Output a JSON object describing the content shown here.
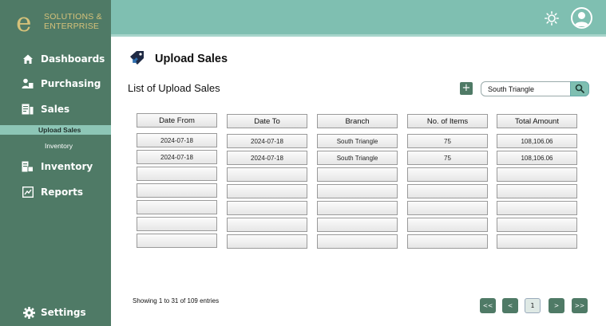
{
  "brand": {
    "line1": "SOLUTIONS &",
    "line2": "ENTERPRISE",
    "mark": "e"
  },
  "colors": {
    "sidebar": "#4f7a66",
    "header": "#7fbfb1",
    "active_sub": "#8dc6b6",
    "logo": "#d6c27a"
  },
  "sidebar": {
    "items": [
      {
        "label": "Dashboards",
        "icon": "home-icon"
      },
      {
        "label": "Purchasing",
        "icon": "users-icon"
      },
      {
        "label": "Sales",
        "icon": "sales-doc-icon"
      },
      {
        "label": "Inventory",
        "icon": "inventory-icon"
      },
      {
        "label": "Reports",
        "icon": "reports-icon"
      }
    ],
    "sales_sub": [
      {
        "label": "Upload Sales",
        "active": true
      },
      {
        "label": "Inventory",
        "active": false
      }
    ],
    "settings": {
      "label": "Settings",
      "icon": "gear-icon"
    }
  },
  "header": {
    "theme_icon": "sun-icon",
    "avatar_icon": "user-avatar-icon"
  },
  "page": {
    "title": "Upload Sales",
    "title_icon": "sales-tag-icon",
    "list_title": "List of Upload Sales",
    "add_label": "+",
    "search": {
      "value": "South Triangle",
      "icon": "search-icon"
    }
  },
  "table": {
    "columns": [
      "Date From",
      "Date To",
      "Branch",
      "No. of Items",
      "Total Amount"
    ],
    "rows": [
      [
        "2024-07-18",
        "2024-07-18",
        "South Triangle",
        "75",
        "108,106.06"
      ],
      [
        "2024-07-18",
        "2024-07-18",
        "South Triangle",
        "75",
        "108,106.06"
      ],
      [
        "",
        "",
        "",
        "",
        ""
      ],
      [
        "",
        "",
        "",
        "",
        ""
      ],
      [
        "",
        "",
        "",
        "",
        ""
      ],
      [
        "",
        "",
        "",
        "",
        ""
      ],
      [
        "",
        "",
        "",
        "",
        ""
      ]
    ]
  },
  "footer": {
    "entries_text": "Showing 1 to 31 of 109 entries",
    "pagination": {
      "first": "<<",
      "prev": "<",
      "current": "1",
      "next": ">",
      "last": ">>"
    }
  }
}
